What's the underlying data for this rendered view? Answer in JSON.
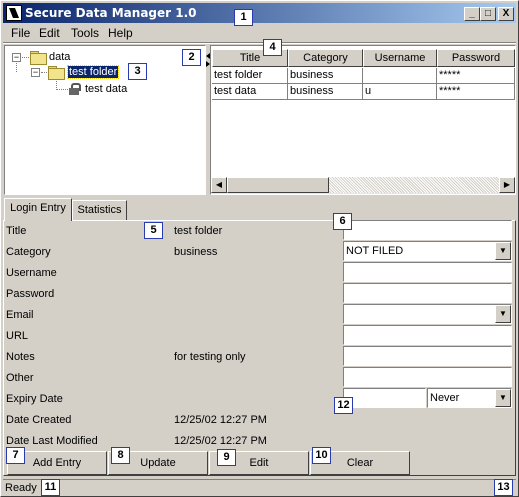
{
  "window": {
    "title": "Secure Data Manager 1.0"
  },
  "menu": [
    "File",
    "Edit",
    "Tools",
    "Help"
  ],
  "window_controls": {
    "minimize": "_",
    "maximize": "□",
    "close": "X"
  },
  "tree": {
    "root": "data",
    "child": "test folder",
    "leaf": "test data"
  },
  "table": {
    "columns": [
      "Title",
      "Category",
      "Username",
      "Password"
    ],
    "rows": [
      [
        "test folder",
        "business",
        "",
        "*****"
      ],
      [
        "test data",
        "business",
        "u",
        "*****"
      ]
    ]
  },
  "tabs": [
    "Login Entry",
    "Statistics"
  ],
  "form": {
    "labels": [
      "Title",
      "Category",
      "Username",
      "Password",
      "Email",
      "URL",
      "Notes",
      "Other",
      "Expiry Date",
      "Date Created",
      "Date Last Modified"
    ],
    "values": {
      "title": "test folder",
      "category": "business",
      "notes": "for testing only",
      "date_created": "12/25/02 12:27 PM",
      "date_modified": "12/25/02 12:27 PM"
    },
    "category_select": "NOT FILED",
    "expiry_select": "Never"
  },
  "buttons": [
    "Add Entry",
    "Update",
    "Edit",
    "Clear"
  ],
  "status": "Ready",
  "badges": [
    "1",
    "2",
    "3",
    "4",
    "5",
    "6",
    "7",
    "8",
    "9",
    "10",
    "11",
    "12",
    "13"
  ]
}
